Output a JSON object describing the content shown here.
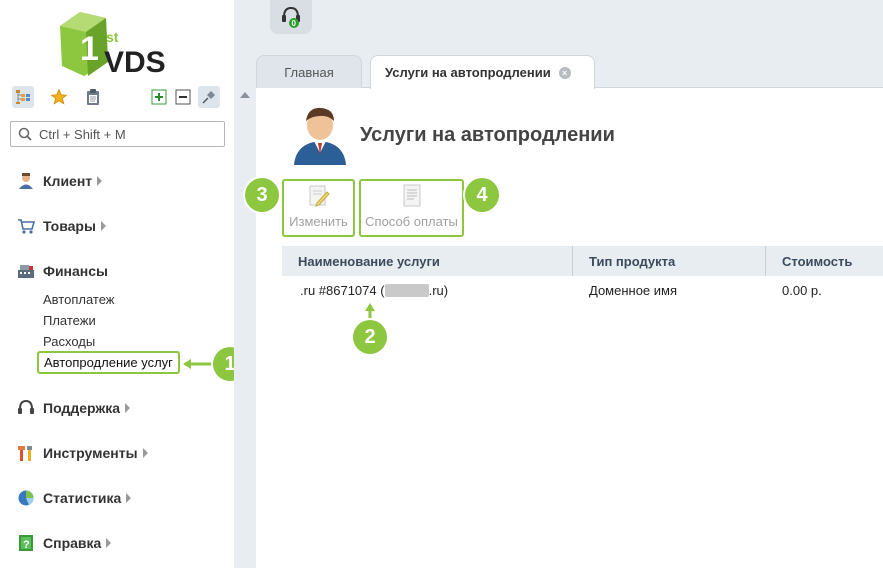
{
  "brand": {
    "logo_text": "VDS",
    "logo_sup": "st"
  },
  "sidebar": {
    "search_placeholder": "Ctrl + Shift + M",
    "groups": [
      {
        "label": "Клиент",
        "icon": "client-icon"
      },
      {
        "label": "Товары",
        "icon": "cart-icon"
      },
      {
        "label": "Финансы",
        "icon": "cash-register-icon",
        "items": [
          {
            "label": "Автоплатеж"
          },
          {
            "label": "Платежи"
          },
          {
            "label": "Расходы"
          },
          {
            "label": "Автопродление услуг"
          }
        ]
      },
      {
        "label": "Поддержка",
        "icon": "headset-icon"
      },
      {
        "label": "Инструменты",
        "icon": "tools-icon"
      },
      {
        "label": "Статистика",
        "icon": "pie-chart-icon"
      },
      {
        "label": "Справка",
        "icon": "help-book-icon"
      }
    ]
  },
  "topbar": {
    "support_badge": "0"
  },
  "tabs": [
    {
      "label": "Главная"
    },
    {
      "label": "Услуги на автопродлении"
    }
  ],
  "page": {
    "title": "Услуги на автопродлении",
    "toolbar": {
      "edit_label": "Изменить",
      "payment_label": "Способ оплаты"
    }
  },
  "grid": {
    "columns": [
      "Наименование услуги",
      "Тип продукта",
      "Стоимость"
    ],
    "rows": [
      {
        "service_prefix": ".ru #8671074 (",
        "service_suffix": ".ru)",
        "type": "Доменное имя",
        "cost": "0.00 р."
      }
    ]
  },
  "callouts": [
    "1",
    "2",
    "3",
    "4"
  ],
  "colors": {
    "accent": "#8dc63f",
    "panel": "#e8edf1"
  }
}
